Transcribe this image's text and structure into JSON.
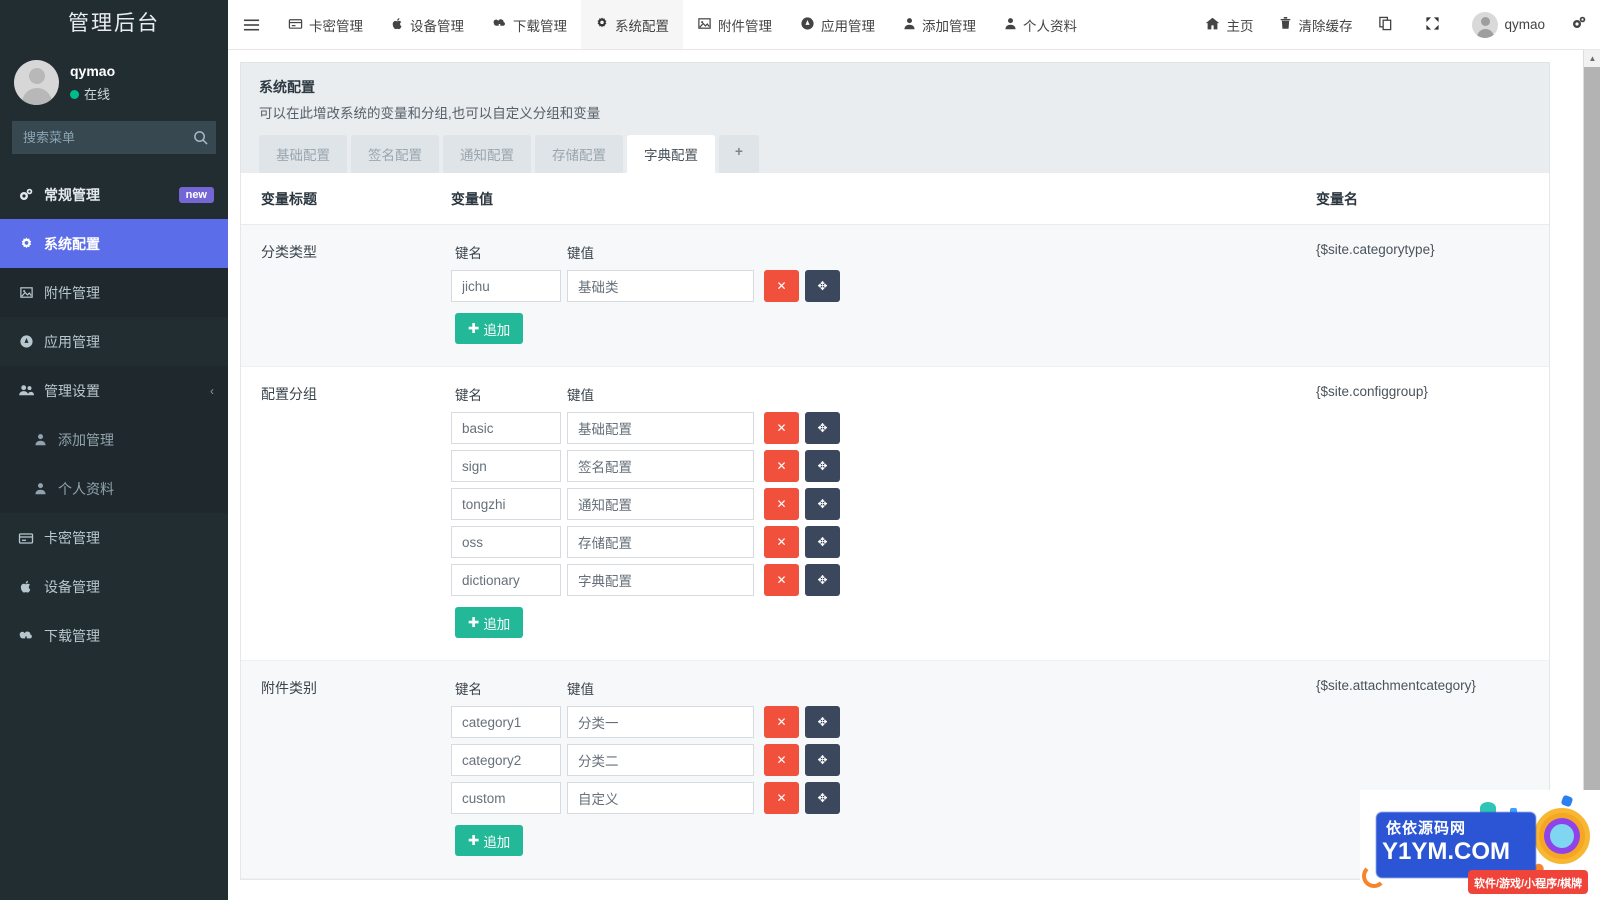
{
  "sidebar": {
    "brand": "管理后台",
    "user": {
      "name": "qymao",
      "status": "在线"
    },
    "search": {
      "placeholder": "搜索菜单",
      "icon": "search-icon"
    },
    "items": [
      {
        "label": "常规管理",
        "icon": "cogs-icon",
        "badge": "new",
        "type": "header"
      },
      {
        "label": "系统配置",
        "icon": "gear-icon",
        "type": "active"
      },
      {
        "label": "附件管理",
        "icon": "image-icon",
        "type": "sub-open"
      },
      {
        "label": "应用管理",
        "icon": "compass-icon",
        "type": "normal"
      },
      {
        "label": "管理设置",
        "icon": "users-icon",
        "type": "sub-open",
        "caret": "‹"
      },
      {
        "label": "添加管理",
        "icon": "user-icon",
        "type": "child"
      },
      {
        "label": "个人资料",
        "icon": "user-icon",
        "type": "child"
      },
      {
        "label": "卡密管理",
        "icon": "credit-card-icon",
        "type": "normal"
      },
      {
        "label": "设备管理",
        "icon": "apple-icon",
        "type": "normal"
      },
      {
        "label": "下载管理",
        "icon": "cloud-download-icon",
        "type": "normal"
      }
    ]
  },
  "navbar": {
    "hamburger_icon": "hamburger-icon",
    "left_links": [
      {
        "label": "卡密管理",
        "icon": "credit-card-icon",
        "current": false
      },
      {
        "label": "设备管理",
        "icon": "apple-icon",
        "current": false
      },
      {
        "label": "下载管理",
        "icon": "cloud-download-icon",
        "current": false
      },
      {
        "label": "系统配置",
        "icon": "gear-icon",
        "current": true
      },
      {
        "label": "附件管理",
        "icon": "image-icon",
        "current": false
      },
      {
        "label": "应用管理",
        "icon": "compass-icon",
        "current": false
      },
      {
        "label": "添加管理",
        "icon": "user-icon",
        "current": false
      },
      {
        "label": "个人资料",
        "icon": "user-icon",
        "current": false
      }
    ],
    "right_links": [
      {
        "label": "主页",
        "icon": "home-icon"
      },
      {
        "label": "清除缓存",
        "icon": "trash-icon"
      },
      {
        "label": "",
        "icon": "copy-icon"
      },
      {
        "label": "",
        "icon": "fullscreen-icon"
      }
    ],
    "user_label": "qymao",
    "settings_icon": "cogs-icon"
  },
  "page": {
    "title": "系统配置",
    "desc": "可以在此增改系统的变量和分组,也可以自定义分组和变量",
    "tabs": [
      {
        "label": "基础配置",
        "active": false
      },
      {
        "label": "签名配置",
        "active": false
      },
      {
        "label": "通知配置",
        "active": false
      },
      {
        "label": "存储配置",
        "active": false
      },
      {
        "label": "字典配置",
        "active": true
      }
    ],
    "tab_add_label": "+"
  },
  "table": {
    "headers": {
      "title": "变量标题",
      "value": "变量值",
      "name": "变量名"
    },
    "kv_headers": {
      "key": "键名",
      "value": "键值"
    },
    "add_label": "追加",
    "delete_icon": "close-icon",
    "move_icon": "move-icon",
    "rows": [
      {
        "title": "分类类型",
        "varname": "{$site.categorytype}",
        "pairs": [
          {
            "key": "jichu",
            "value": "基础类"
          }
        ]
      },
      {
        "title": "配置分组",
        "varname": "{$site.configgroup}",
        "pairs": [
          {
            "key": "basic",
            "value": "基础配置"
          },
          {
            "key": "sign",
            "value": "签名配置"
          },
          {
            "key": "tongzhi",
            "value": "通知配置"
          },
          {
            "key": "oss",
            "value": "存储配置"
          },
          {
            "key": "dictionary",
            "value": "字典配置"
          }
        ]
      },
      {
        "title": "附件类别",
        "varname": "{$site.attachmentcategory}",
        "pairs": [
          {
            "key": "category1",
            "value": "分类一"
          },
          {
            "key": "category2",
            "value": "分类二"
          },
          {
            "key": "custom",
            "value": "自定义"
          }
        ]
      }
    ]
  },
  "watermark": {
    "line1": "依依源码网",
    "line2": "Y1YM.COM",
    "line3": "软件/游戏/小程序/棋牌"
  },
  "colors": {
    "sidebar_bg": "#222d32",
    "active_menu": "#5b6de8",
    "badge_new": "#7566d6",
    "online_dot": "#00bc8c",
    "delete_btn": "#f0503c",
    "move_btn": "#3b475c",
    "add_btn": "#23b898"
  }
}
